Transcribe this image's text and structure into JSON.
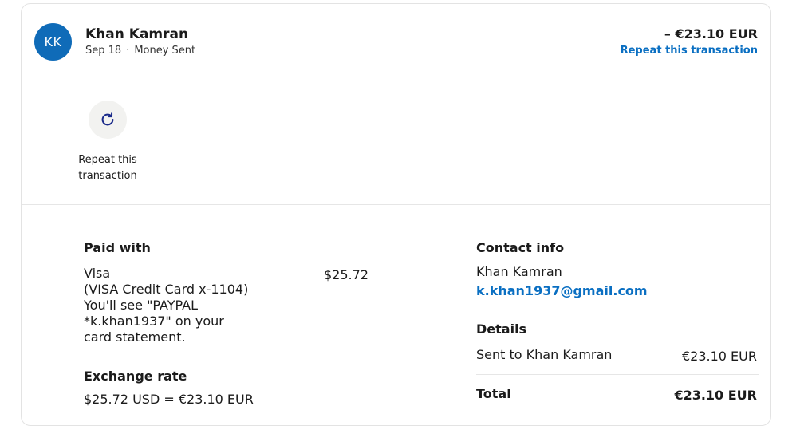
{
  "header": {
    "avatar_initials": "KK",
    "name": "Khan Kamran",
    "date": "Sep 18",
    "separator": "·",
    "type": "Money Sent",
    "amount": "– €23.10 EUR",
    "repeat_link": "Repeat this transaction"
  },
  "action": {
    "repeat_icon": "refresh-icon",
    "repeat_label": "Repeat this transaction"
  },
  "paid_with": {
    "title": "Paid with",
    "lines": [
      "Visa",
      "(VISA Credit Card x-1104)",
      "You'll see \"PAYPAL",
      "*k.khan1937\" on your",
      "card statement."
    ],
    "amount": "$25.72"
  },
  "exchange_rate": {
    "title": "Exchange rate",
    "line1": "$25.72 USD = €23.10 EUR"
  },
  "contact": {
    "title": "Contact info",
    "name": "Khan Kamran",
    "email": "k.khan1937@gmail.com"
  },
  "details": {
    "title": "Details",
    "sent_label": "Sent to Khan Kamran",
    "sent_amount": "€23.10 EUR",
    "total_label": "Total",
    "total_amount": "€23.10 EUR"
  },
  "colors": {
    "avatar": "#0f6bb8",
    "link": "#0a6fc2",
    "border": "#e3e3e3"
  }
}
